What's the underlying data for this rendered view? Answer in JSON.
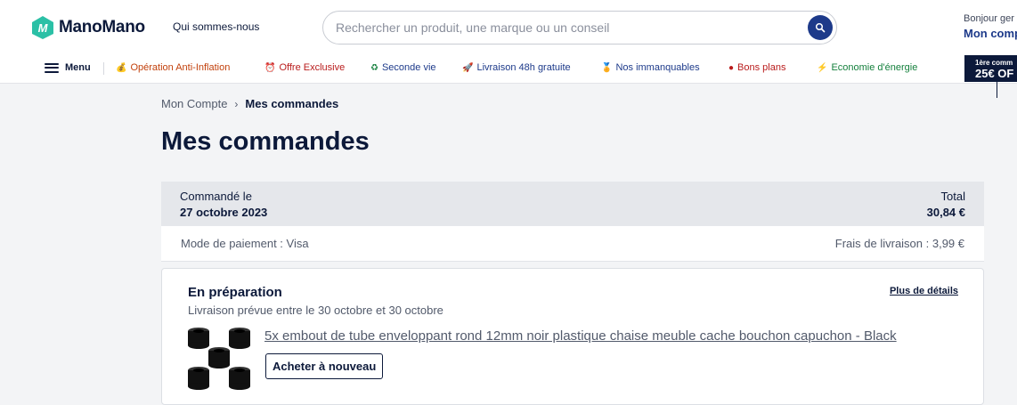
{
  "header": {
    "logo_text": "ManoMano",
    "about_link": "Qui sommes-nous",
    "search": {
      "placeholder": "Rechercher un produit, une marque ou un conseil"
    },
    "account": {
      "greeting": "Bonjour ger",
      "title": "Mon comp"
    }
  },
  "nav": {
    "menu_label": "Menu",
    "items": [
      {
        "label": "Opération Anti-Inflation",
        "icon": "money-bag-icon",
        "glyph": "💰",
        "color": "#c2410c"
      },
      {
        "label": "Offre Exclusive",
        "icon": "clock-icon",
        "glyph": "⏰",
        "color": "#b91c1c"
      },
      {
        "label": "Seconde vie",
        "icon": "recycle-icon",
        "glyph": "♻",
        "color": "#1d3a8a"
      },
      {
        "label": "Livraison 48h gratuite",
        "icon": "rocket-icon",
        "glyph": "🚀",
        "color": "#1d3a8a"
      },
      {
        "label": "Nos immanquables",
        "icon": "medal-icon",
        "glyph": "🏅",
        "color": "#1d3a8a"
      },
      {
        "label": "Bons plans",
        "icon": "red-dot-icon",
        "glyph": "●",
        "color": "#b91c1c"
      },
      {
        "label": "Economie d'énergie",
        "icon": "lightning-icon",
        "glyph": "⚡",
        "color": "#15803d"
      }
    ],
    "promo": {
      "line1": "1ère comm",
      "line2": "25€ OF"
    }
  },
  "breadcrumb": {
    "parent": "Mon Compte",
    "current": "Mes commandes"
  },
  "page_title": "Mes commandes",
  "order": {
    "ordered_label": "Commandé le",
    "ordered_date": "27 octobre 2023",
    "total_label": "Total",
    "total_value": "30,84 €",
    "payment": "Mode de paiement : Visa",
    "shipping": "Frais de livraison : 3,99 €",
    "status": "En préparation",
    "details_link": "Plus de détails",
    "delivery": "Livraison prévue entre le 30 octobre et 30 octobre",
    "product_title": "5x embout de tube enveloppant rond 12mm noir plastique chaise meuble cache bouchon capuchon - Black",
    "rebuy_button": "Acheter à nouveau"
  },
  "colors": {
    "brand": "#0c193a",
    "accent": "#1d3a8a",
    "logo": "#2bc0a6"
  }
}
